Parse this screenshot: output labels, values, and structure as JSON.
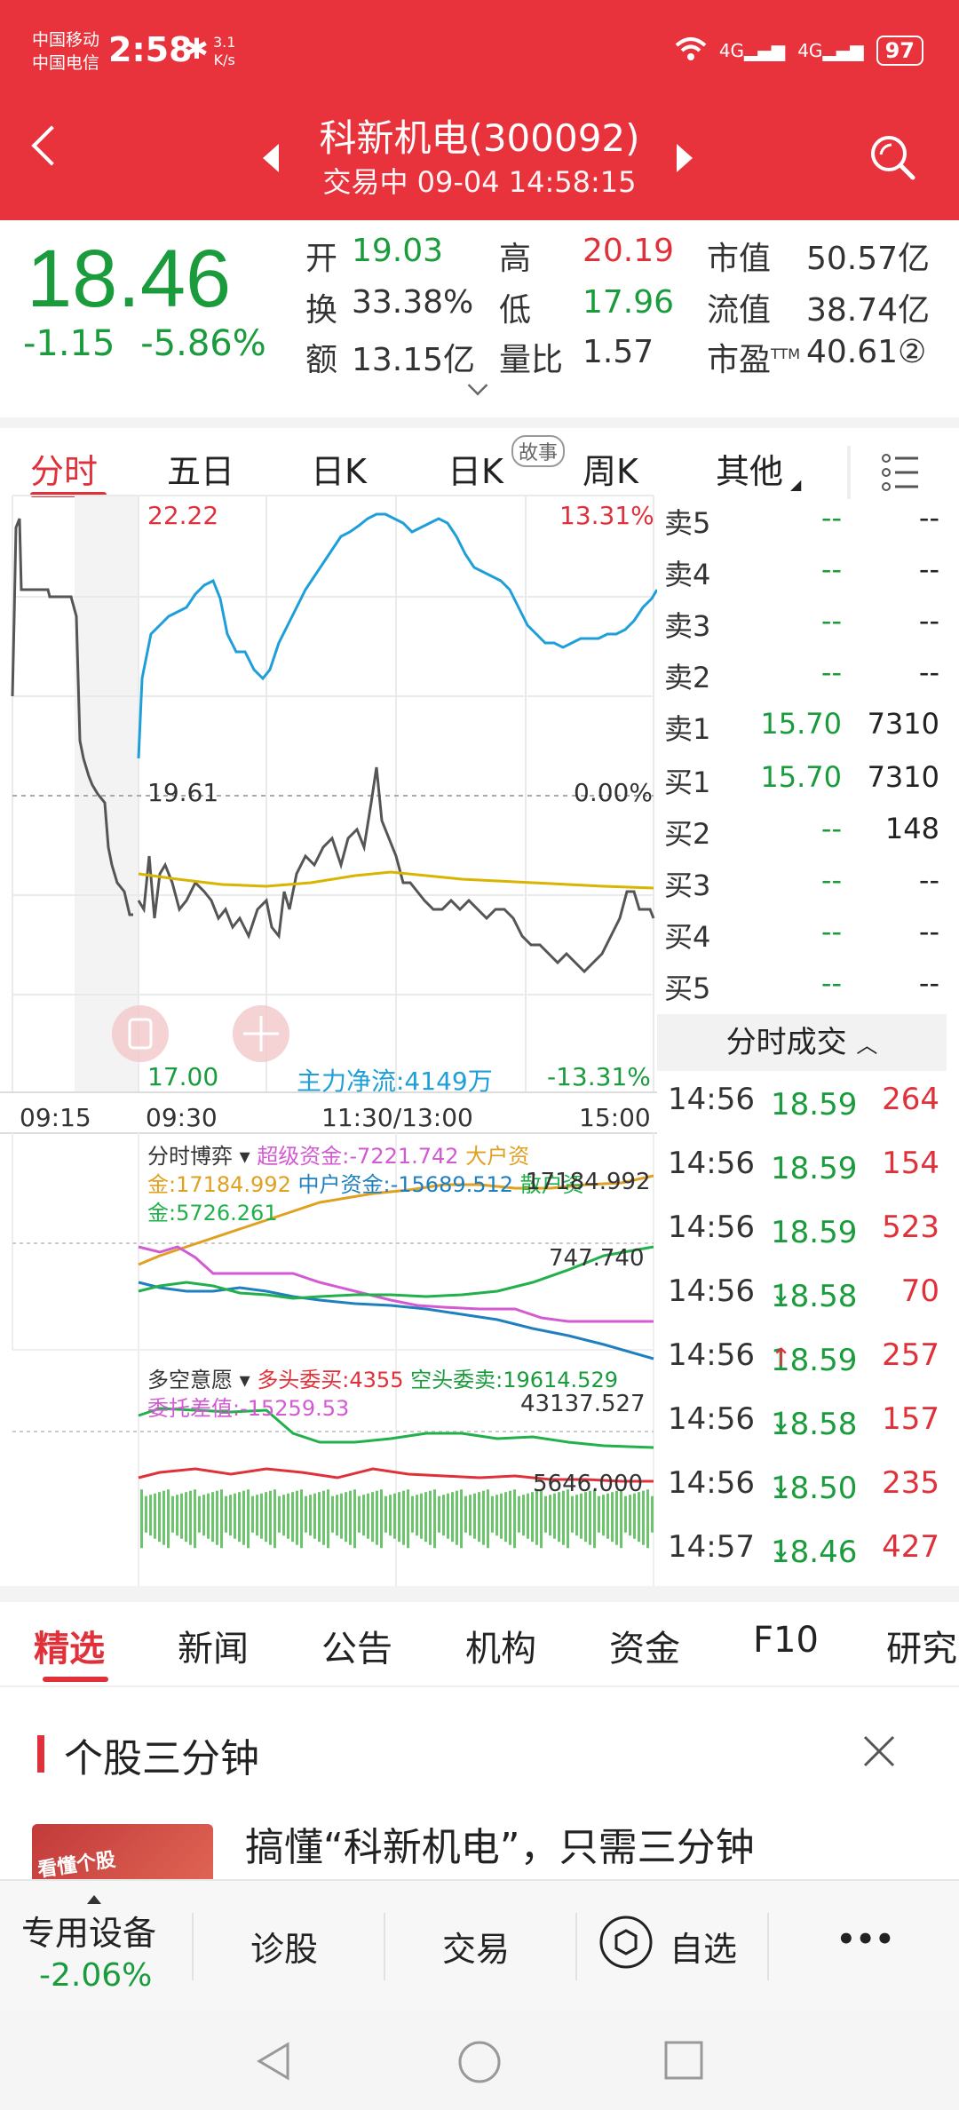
{
  "status_bar": {
    "carrier1": "中国移动",
    "carrier2": "中国电信",
    "time": "2:58",
    "speed_value": "3.1",
    "speed_unit": "K/s",
    "signal1": "4G",
    "signal2": "4G",
    "battery": "97"
  },
  "header": {
    "title": "科新机电(300092)",
    "subtitle": "交易中  09-04 14:58:15"
  },
  "quote": {
    "price": "18.46",
    "change": "-1.15",
    "change_pct": "-5.86%",
    "open_label": "开",
    "open": "19.03",
    "high_label": "高",
    "high": "20.19",
    "mktcap_label": "市值",
    "mktcap": "50.57亿",
    "turnover_label": "换",
    "turnover": "33.38%",
    "low_label": "低",
    "low": "17.96",
    "float_label": "流值",
    "float": "38.74亿",
    "amount_label": "额",
    "amount": "13.15亿",
    "volratio_label": "量比",
    "volratio": "1.57",
    "pe_label": "市盈",
    "pe_sup": "TTM",
    "pe": "40.61②"
  },
  "chart_tabs": [
    "分时",
    "五日",
    "日K",
    "日K",
    "周K",
    "其他"
  ],
  "story_badge": "故事",
  "chart": {
    "top_price": "22.22",
    "top_pct": "13.31%",
    "mid_price": "19.61",
    "mid_pct": "0.00%",
    "bottom_price": "17.00",
    "bottom_pct": "-13.31%",
    "main_flow": "主力净流:4149万",
    "time_labels": [
      "09:15",
      "09:30",
      "11:30/13:00",
      "15:00"
    ],
    "panel2_title": "分时博弈",
    "panel2_legend1": "超级资金:-7221.742",
    "panel2_legend2": "大户资金:17184.992",
    "panel2_legend3": "中户资金:-15689.512",
    "panel2_legend4": "散户资金:5726.261",
    "panel2_max": "17184.992",
    "panel2_mid": "747.740",
    "panel3_title": "多空意愿",
    "panel3_legend1": "多头委买:4355",
    "panel3_legend2": "空头委卖:19614.529",
    "panel3_legend3": "委托差值:-15259.53",
    "panel3_max": "43137.527",
    "panel3_mid": "5646.000",
    "colors": {
      "price_line": "#555555",
      "pct_line": "#1e9fd9",
      "avg_line": "#d9b400",
      "super_funds": "#d25ad2",
      "big_funds": "#e0a020",
      "mid_funds": "#1f7fbf",
      "retail_funds": "#22b04b"
    }
  },
  "chart_data": {
    "type": "line",
    "title": "",
    "ylim": [
      17.0,
      22.22
    ],
    "prev_close": 19.61,
    "x": [
      "09:15",
      "09:30",
      "11:30/13:00",
      "15:00"
    ],
    "series": []
  },
  "order_book": {
    "asks": [
      {
        "name": "卖5",
        "price": "--",
        "vol": "--"
      },
      {
        "name": "卖4",
        "price": "--",
        "vol": "--"
      },
      {
        "name": "卖3",
        "price": "--",
        "vol": "--"
      },
      {
        "name": "卖2",
        "price": "--",
        "vol": "--"
      },
      {
        "name": "卖1",
        "price": "15.70",
        "vol": "7310"
      }
    ],
    "bids": [
      {
        "name": "买1",
        "price": "15.70",
        "vol": "7310"
      },
      {
        "name": "买2",
        "price": "--",
        "vol": "148"
      },
      {
        "name": "买3",
        "price": "--",
        "vol": "--"
      },
      {
        "name": "买4",
        "price": "--",
        "vol": "--"
      },
      {
        "name": "买5",
        "price": "--",
        "vol": "--"
      }
    ]
  },
  "trades_header": "分时成交",
  "trades": [
    {
      "time": "14:56",
      "price": "18.59",
      "arrow": "",
      "vol": "264"
    },
    {
      "time": "14:56",
      "price": "18.59",
      "arrow": "",
      "vol": "154"
    },
    {
      "time": "14:56",
      "price": "18.59",
      "arrow": "",
      "vol": "523"
    },
    {
      "time": "14:56",
      "price": "18.58",
      "arrow": "↓",
      "vol": "70"
    },
    {
      "time": "14:56",
      "price": "18.59",
      "arrow": "↑",
      "vol": "257"
    },
    {
      "time": "14:56",
      "price": "18.58",
      "arrow": "↓",
      "vol": "157"
    },
    {
      "time": "14:56",
      "price": "18.50",
      "arrow": "↓",
      "vol": "235"
    },
    {
      "time": "14:57",
      "price": "18.46",
      "arrow": "↓",
      "vol": "427"
    }
  ],
  "news_tabs": [
    "精选",
    "新闻",
    "公告",
    "机构",
    "资金",
    "F10",
    "研究"
  ],
  "section": {
    "title": "个股三分钟",
    "article_title": "搞懂“科新机电”，只需三分钟",
    "thumb_text": "看懂个股"
  },
  "bottom_bar": {
    "sector": "专用设备",
    "sector_pct": "-2.06%",
    "diagnose": "诊股",
    "trade": "交易",
    "watchlist": "自选",
    "more": "•••"
  }
}
